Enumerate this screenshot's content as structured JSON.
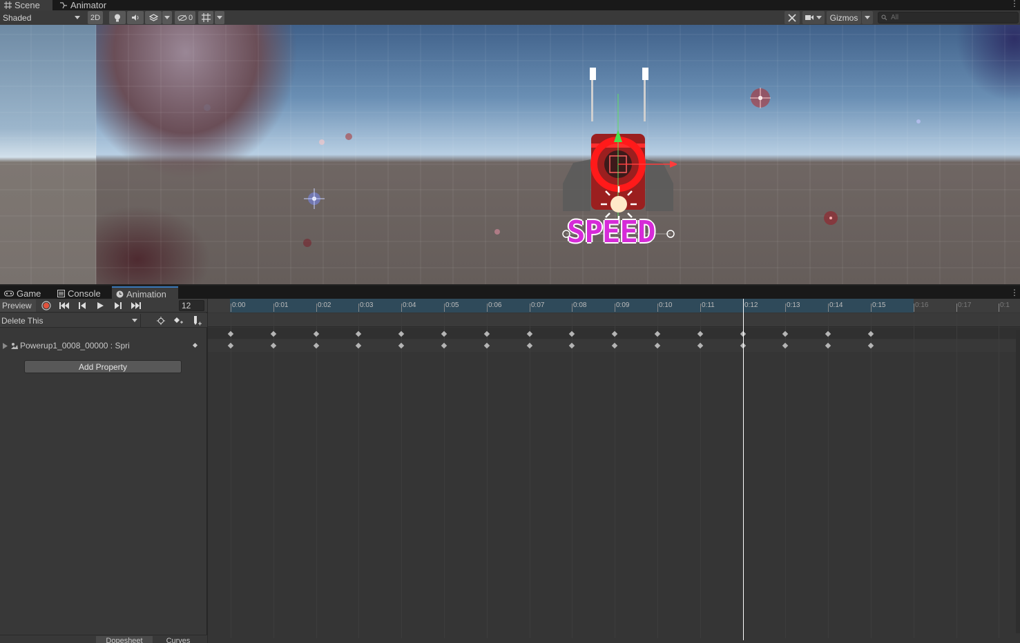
{
  "top_tabs": [
    {
      "label": "Scene",
      "icon": "grid-hash-icon"
    },
    {
      "label": "Animator",
      "icon": "animator-flow-icon"
    }
  ],
  "scene_toolbar": {
    "draw_mode": "Shaded",
    "mode_2d": "2D",
    "hidden_count": "0",
    "gizmos_label": "Gizmos",
    "search_placeholder": "All"
  },
  "scene": {
    "sprite_text": "SPEED",
    "accent_text_color": "#d62bd8"
  },
  "bottom_tabs": [
    {
      "label": "Game",
      "icon": "gamepad-icon"
    },
    {
      "label": "Console",
      "icon": "console-list-icon"
    },
    {
      "label": "Animation",
      "icon": "clock-icon",
      "active": true
    }
  ],
  "animation": {
    "preview_label": "Preview",
    "frame_value": "12",
    "clip_name": "Delete This",
    "property_row": "Powerup1_0008_00000 : Spri",
    "add_property_label": "Add Property",
    "bottom_tabs": [
      "Dopesheet",
      "Curves"
    ],
    "timeline_labels": [
      "0:00",
      "0:01",
      "0:02",
      "0:03",
      "0:04",
      "0:05",
      "0:06",
      "0:07",
      "0:08",
      "0:09",
      "0:10",
      "0:11",
      "0:12",
      "0:13",
      "0:14",
      "0:15",
      "0:16",
      "0:17",
      "0:1"
    ],
    "playhead_frame": 12,
    "keyframe_count": 16,
    "colors": {
      "record": "#e0533e",
      "timeline_active": "#2f4a5a",
      "playhead": "#ffffff"
    }
  }
}
